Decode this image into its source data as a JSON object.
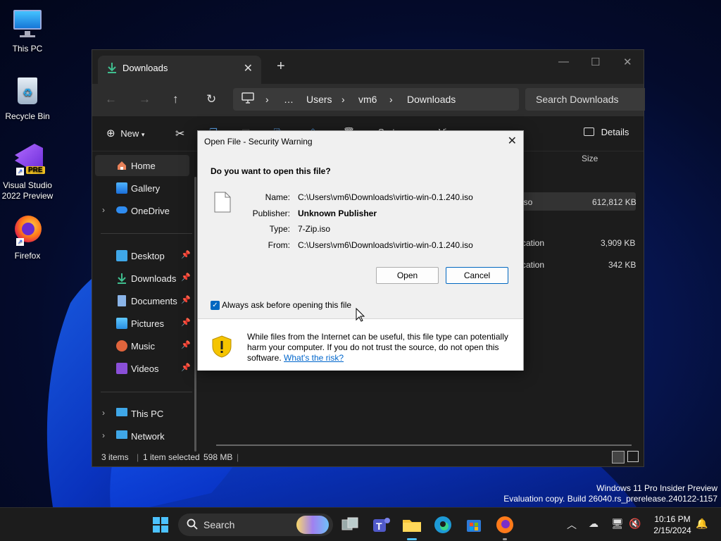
{
  "desktop": {
    "icons": [
      {
        "label": "This PC"
      },
      {
        "label": "Recycle Bin"
      },
      {
        "label": "Visual Studio 2022 Preview",
        "badge": "PRE"
      },
      {
        "label": "Firefox"
      }
    ],
    "watermark": {
      "line1": "Windows 11 Pro Insider Preview",
      "line2": "Evaluation copy. Build 26040.rs_prerelease.240122-1157"
    }
  },
  "explorer": {
    "tab": {
      "title": "Downloads"
    },
    "address": {
      "root": "…",
      "parts": [
        "Users",
        "vm6",
        "Downloads"
      ]
    },
    "search_placeholder": "Search Downloads",
    "commands": {
      "new": "New",
      "sort": "Sort",
      "view": "View",
      "details": "Details"
    },
    "columns": {
      "size": "Size"
    },
    "sidebar": {
      "home": "Home",
      "gallery": "Gallery",
      "onedrive": "OneDrive",
      "desktop": "Desktop",
      "downloads": "Downloads",
      "documents": "Documents",
      "pictures": "Pictures",
      "music": "Music",
      "videos": "Videos",
      "thispc": "This PC",
      "network": "Network"
    },
    "rows": [
      {
        "type_fragment": "iso",
        "size": "612,812 KB"
      },
      {
        "type_fragment": "cation",
        "size": "3,909 KB"
      },
      {
        "type_fragment": "cation",
        "size": "342 KB"
      }
    ],
    "status": {
      "count": "3 items",
      "selected": "1 item selected",
      "size": "598 MB"
    }
  },
  "dialog": {
    "title": "Open File - Security Warning",
    "question": "Do you want to open this file?",
    "fields": {
      "name_label": "Name:",
      "name_value": "C:\\Users\\vm6\\Downloads\\virtio-win-0.1.240.iso",
      "publisher_label": "Publisher:",
      "publisher_value": "Unknown Publisher",
      "type_label": "Type:",
      "type_value": "7-Zip.iso",
      "from_label": "From:",
      "from_value": "C:\\Users\\vm6\\Downloads\\virtio-win-0.1.240.iso"
    },
    "open_label": "Open",
    "cancel_label": "Cancel",
    "checkbox_label": "Always ask before opening this file",
    "checkbox_checked": true,
    "warning_text": "While files from the Internet can be useful, this file type can potentially harm your computer. If you do not trust the source, do not open this software.",
    "warning_link": "What's the risk?"
  },
  "taskbar": {
    "search_label": "Search",
    "clock_time": "10:16 PM",
    "clock_date": "2/15/2024"
  },
  "colors": {
    "accent": "#0067c0",
    "link": "#0066cc",
    "shield": "#f5c400"
  }
}
